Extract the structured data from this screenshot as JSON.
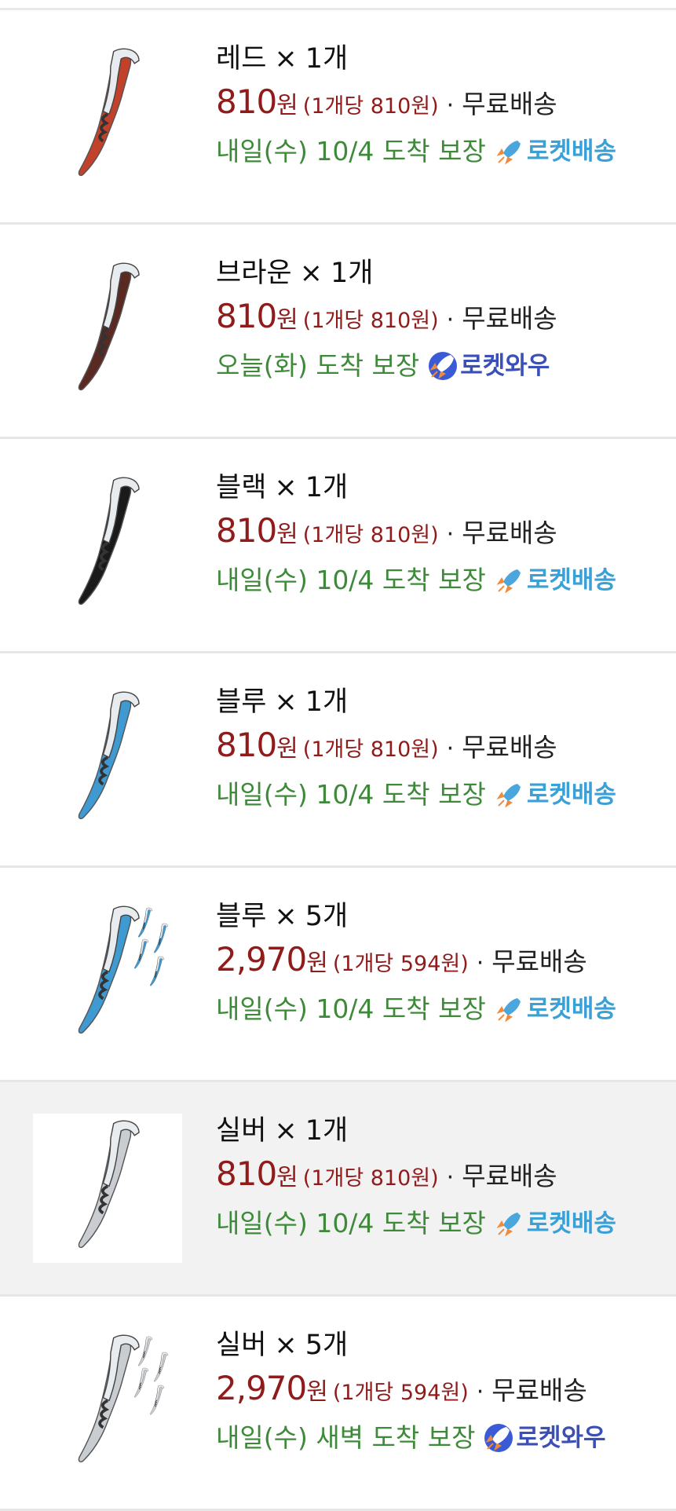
{
  "items": [
    {
      "color_label": "레드",
      "times": "×",
      "qty": "1개",
      "price": "810",
      "won": "원",
      "unit_price": "(1개당 810원)",
      "dot": "·",
      "shipping": "무료배송",
      "delivery": "내일(수) 10/4 도착 보장",
      "badge": "로켓배송",
      "badge_type": "rocket",
      "image_color": "#c2412a",
      "selected": false,
      "multi": false
    },
    {
      "color_label": "브라운",
      "times": "×",
      "qty": "1개",
      "price": "810",
      "won": "원",
      "unit_price": "(1개당 810원)",
      "dot": "·",
      "shipping": "무료배송",
      "delivery": "오늘(화) 도착 보장",
      "badge": "로켓와우",
      "badge_type": "wow",
      "image_color": "#5a2a22",
      "selected": false,
      "multi": false
    },
    {
      "color_label": "블랙",
      "times": "×",
      "qty": "1개",
      "price": "810",
      "won": "원",
      "unit_price": "(1개당 810원)",
      "dot": "·",
      "shipping": "무료배송",
      "delivery": "내일(수) 10/4 도착 보장",
      "badge": "로켓배송",
      "badge_type": "rocket",
      "image_color": "#1a1a1a",
      "selected": false,
      "multi": false
    },
    {
      "color_label": "블루",
      "times": "×",
      "qty": "1개",
      "price": "810",
      "won": "원",
      "unit_price": "(1개당 810원)",
      "dot": "·",
      "shipping": "무료배송",
      "delivery": "내일(수) 10/4 도착 보장",
      "badge": "로켓배송",
      "badge_type": "rocket",
      "image_color": "#3f9ad1",
      "selected": false,
      "multi": false
    },
    {
      "color_label": "블루",
      "times": "×",
      "qty": "5개",
      "price": "2,970",
      "won": "원",
      "unit_price": "(1개당 594원)",
      "dot": "·",
      "shipping": "무료배송",
      "delivery": "내일(수) 10/4 도착 보장",
      "badge": "로켓배송",
      "badge_type": "rocket",
      "image_color": "#3f9ad1",
      "selected": false,
      "multi": true
    },
    {
      "color_label": "실버",
      "times": "×",
      "qty": "1개",
      "price": "810",
      "won": "원",
      "unit_price": "(1개당 810원)",
      "dot": "·",
      "shipping": "무료배송",
      "delivery": "내일(수) 10/4 도착 보장",
      "badge": "로켓배송",
      "badge_type": "rocket",
      "image_color": "#c9cdd2",
      "selected": true,
      "multi": false
    },
    {
      "color_label": "실버",
      "times": "×",
      "qty": "5개",
      "price": "2,970",
      "won": "원",
      "unit_price": "(1개당 594원)",
      "dot": "·",
      "shipping": "무료배송",
      "delivery": "내일(수) 새벽 도착 보장",
      "badge": "로켓와우",
      "badge_type": "wow",
      "image_color": "#c9cdd2",
      "selected": false,
      "multi": true
    }
  ]
}
